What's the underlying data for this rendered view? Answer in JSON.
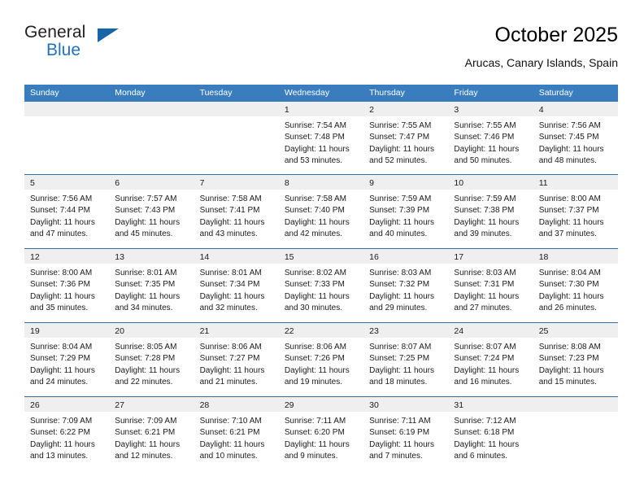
{
  "brand": {
    "word1": "General",
    "word2": "Blue",
    "accent_color": "#1565a8"
  },
  "header": {
    "title": "October 2025",
    "location": "Arucas, Canary Islands, Spain"
  },
  "calendar": {
    "header_color": "#3a7dbf",
    "weekdays": [
      "Sunday",
      "Monday",
      "Tuesday",
      "Wednesday",
      "Thursday",
      "Friday",
      "Saturday"
    ],
    "weeks": [
      [
        {
          "day": "",
          "lines": []
        },
        {
          "day": "",
          "lines": []
        },
        {
          "day": "",
          "lines": []
        },
        {
          "day": "1",
          "lines": [
            "Sunrise: 7:54 AM",
            "Sunset: 7:48 PM",
            "Daylight: 11 hours",
            "and 53 minutes."
          ]
        },
        {
          "day": "2",
          "lines": [
            "Sunrise: 7:55 AM",
            "Sunset: 7:47 PM",
            "Daylight: 11 hours",
            "and 52 minutes."
          ]
        },
        {
          "day": "3",
          "lines": [
            "Sunrise: 7:55 AM",
            "Sunset: 7:46 PM",
            "Daylight: 11 hours",
            "and 50 minutes."
          ]
        },
        {
          "day": "4",
          "lines": [
            "Sunrise: 7:56 AM",
            "Sunset: 7:45 PM",
            "Daylight: 11 hours",
            "and 48 minutes."
          ]
        }
      ],
      [
        {
          "day": "5",
          "lines": [
            "Sunrise: 7:56 AM",
            "Sunset: 7:44 PM",
            "Daylight: 11 hours",
            "and 47 minutes."
          ]
        },
        {
          "day": "6",
          "lines": [
            "Sunrise: 7:57 AM",
            "Sunset: 7:43 PM",
            "Daylight: 11 hours",
            "and 45 minutes."
          ]
        },
        {
          "day": "7",
          "lines": [
            "Sunrise: 7:58 AM",
            "Sunset: 7:41 PM",
            "Daylight: 11 hours",
            "and 43 minutes."
          ]
        },
        {
          "day": "8",
          "lines": [
            "Sunrise: 7:58 AM",
            "Sunset: 7:40 PM",
            "Daylight: 11 hours",
            "and 42 minutes."
          ]
        },
        {
          "day": "9",
          "lines": [
            "Sunrise: 7:59 AM",
            "Sunset: 7:39 PM",
            "Daylight: 11 hours",
            "and 40 minutes."
          ]
        },
        {
          "day": "10",
          "lines": [
            "Sunrise: 7:59 AM",
            "Sunset: 7:38 PM",
            "Daylight: 11 hours",
            "and 39 minutes."
          ]
        },
        {
          "day": "11",
          "lines": [
            "Sunrise: 8:00 AM",
            "Sunset: 7:37 PM",
            "Daylight: 11 hours",
            "and 37 minutes."
          ]
        }
      ],
      [
        {
          "day": "12",
          "lines": [
            "Sunrise: 8:00 AM",
            "Sunset: 7:36 PM",
            "Daylight: 11 hours",
            "and 35 minutes."
          ]
        },
        {
          "day": "13",
          "lines": [
            "Sunrise: 8:01 AM",
            "Sunset: 7:35 PM",
            "Daylight: 11 hours",
            "and 34 minutes."
          ]
        },
        {
          "day": "14",
          "lines": [
            "Sunrise: 8:01 AM",
            "Sunset: 7:34 PM",
            "Daylight: 11 hours",
            "and 32 minutes."
          ]
        },
        {
          "day": "15",
          "lines": [
            "Sunrise: 8:02 AM",
            "Sunset: 7:33 PM",
            "Daylight: 11 hours",
            "and 30 minutes."
          ]
        },
        {
          "day": "16",
          "lines": [
            "Sunrise: 8:03 AM",
            "Sunset: 7:32 PM",
            "Daylight: 11 hours",
            "and 29 minutes."
          ]
        },
        {
          "day": "17",
          "lines": [
            "Sunrise: 8:03 AM",
            "Sunset: 7:31 PM",
            "Daylight: 11 hours",
            "and 27 minutes."
          ]
        },
        {
          "day": "18",
          "lines": [
            "Sunrise: 8:04 AM",
            "Sunset: 7:30 PM",
            "Daylight: 11 hours",
            "and 26 minutes."
          ]
        }
      ],
      [
        {
          "day": "19",
          "lines": [
            "Sunrise: 8:04 AM",
            "Sunset: 7:29 PM",
            "Daylight: 11 hours",
            "and 24 minutes."
          ]
        },
        {
          "day": "20",
          "lines": [
            "Sunrise: 8:05 AM",
            "Sunset: 7:28 PM",
            "Daylight: 11 hours",
            "and 22 minutes."
          ]
        },
        {
          "day": "21",
          "lines": [
            "Sunrise: 8:06 AM",
            "Sunset: 7:27 PM",
            "Daylight: 11 hours",
            "and 21 minutes."
          ]
        },
        {
          "day": "22",
          "lines": [
            "Sunrise: 8:06 AM",
            "Sunset: 7:26 PM",
            "Daylight: 11 hours",
            "and 19 minutes."
          ]
        },
        {
          "day": "23",
          "lines": [
            "Sunrise: 8:07 AM",
            "Sunset: 7:25 PM",
            "Daylight: 11 hours",
            "and 18 minutes."
          ]
        },
        {
          "day": "24",
          "lines": [
            "Sunrise: 8:07 AM",
            "Sunset: 7:24 PM",
            "Daylight: 11 hours",
            "and 16 minutes."
          ]
        },
        {
          "day": "25",
          "lines": [
            "Sunrise: 8:08 AM",
            "Sunset: 7:23 PM",
            "Daylight: 11 hours",
            "and 15 minutes."
          ]
        }
      ],
      [
        {
          "day": "26",
          "lines": [
            "Sunrise: 7:09 AM",
            "Sunset: 6:22 PM",
            "Daylight: 11 hours",
            "and 13 minutes."
          ]
        },
        {
          "day": "27",
          "lines": [
            "Sunrise: 7:09 AM",
            "Sunset: 6:21 PM",
            "Daylight: 11 hours",
            "and 12 minutes."
          ]
        },
        {
          "day": "28",
          "lines": [
            "Sunrise: 7:10 AM",
            "Sunset: 6:21 PM",
            "Daylight: 11 hours",
            "and 10 minutes."
          ]
        },
        {
          "day": "29",
          "lines": [
            "Sunrise: 7:11 AM",
            "Sunset: 6:20 PM",
            "Daylight: 11 hours",
            "and 9 minutes."
          ]
        },
        {
          "day": "30",
          "lines": [
            "Sunrise: 7:11 AM",
            "Sunset: 6:19 PM",
            "Daylight: 11 hours",
            "and 7 minutes."
          ]
        },
        {
          "day": "31",
          "lines": [
            "Sunrise: 7:12 AM",
            "Sunset: 6:18 PM",
            "Daylight: 11 hours",
            "and 6 minutes."
          ]
        },
        {
          "day": "",
          "lines": []
        }
      ]
    ]
  }
}
